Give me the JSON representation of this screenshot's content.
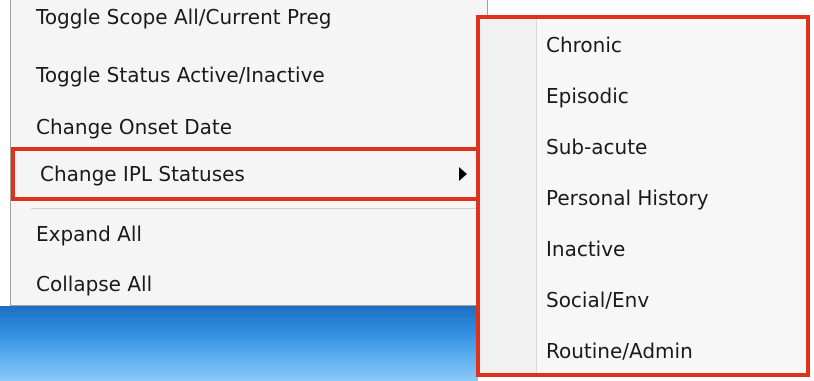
{
  "context_menu": {
    "items": [
      {
        "label": "Toggle Scope All/Current Preg"
      },
      {
        "label": "Toggle Status Active/Inactive"
      },
      {
        "label": "Change Onset Date"
      },
      {
        "label": "Change IPL Statuses",
        "has_submenu": true,
        "highlighted": true
      },
      {
        "label": "Expand All"
      },
      {
        "label": "Collapse All"
      }
    ]
  },
  "submenu": {
    "items": [
      {
        "label": "Chronic"
      },
      {
        "label": "Episodic"
      },
      {
        "label": "Sub-acute"
      },
      {
        "label": "Personal History"
      },
      {
        "label": "Inactive"
      },
      {
        "label": "Social/Env"
      },
      {
        "label": "Routine/Admin"
      }
    ]
  },
  "colors": {
    "highlight_border": "#e0311b",
    "menu_background": "#f5f5f5",
    "desktop_background": "#2f8ee0"
  },
  "icons": {
    "submenu_arrow": "chevron-right-icon"
  }
}
